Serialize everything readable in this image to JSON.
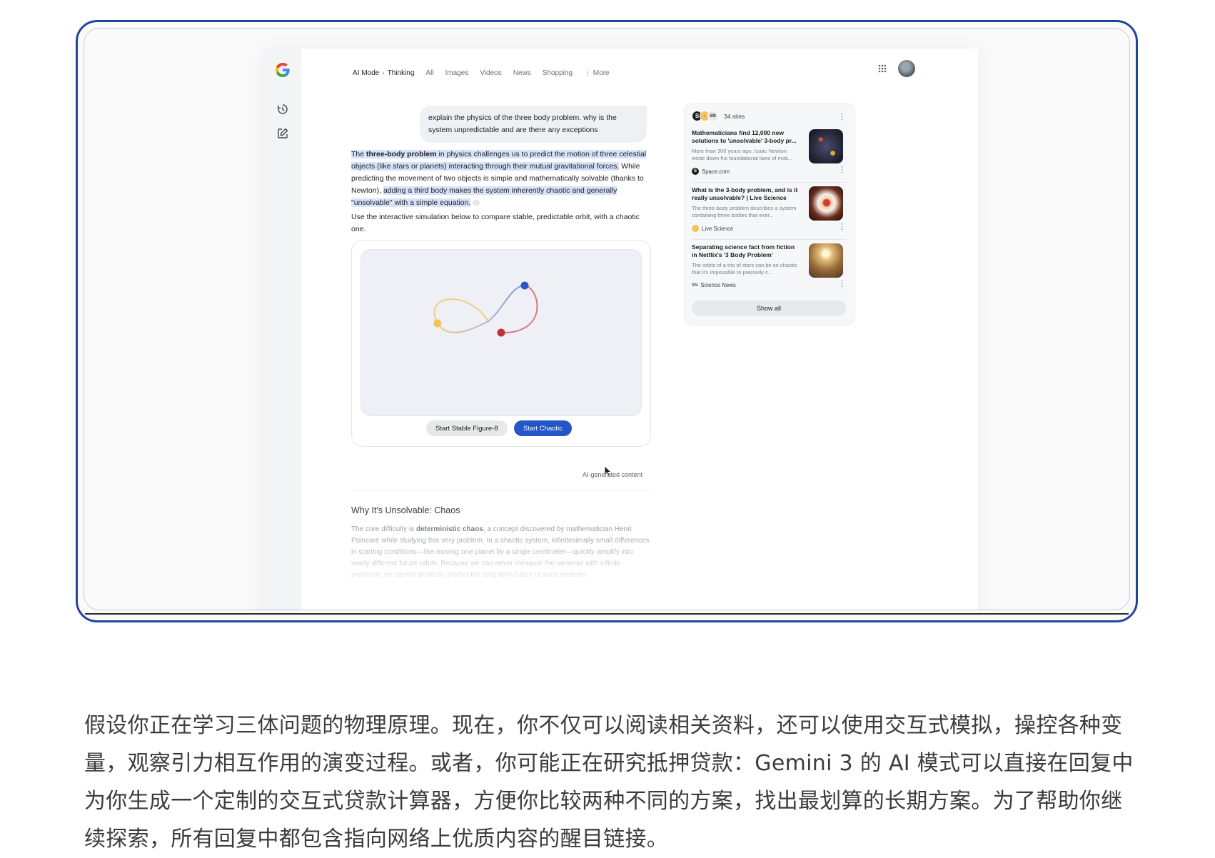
{
  "nav": {
    "mode": "AI Mode",
    "thinking": "Thinking",
    "tabs": [
      "All",
      "Images",
      "Videos",
      "News",
      "Shopping"
    ],
    "more": "More"
  },
  "chat": {
    "query": "explain the physics of the three body problem. why is the system unpredictable and are there any exceptions",
    "answer": {
      "p1": "The ",
      "p1_bold": "three-body problem",
      "p1_rest": " in physics challenges us to predict the motion of three celestial objects (like stars or planets) interacting through their mutual gravitational forces.",
      "p2": " While predicting the movement of two objects is simple and mathematically solvable (thanks to Newton), ",
      "p3": "adding a third body makes the system inherently chaotic and generally \"unsolvable\" with a simple equation."
    },
    "note": "Use the interactive simulation below to compare stable, predictable orbit, with a chaotic one.",
    "sim": {
      "btn_stable": "Start Stable Figure-8",
      "btn_chaotic": "Start Chaotic"
    },
    "ai_label": "AI-generated content",
    "section_title": "Why It's Unsolvable: Chaos",
    "section_text_pre": "The core difficulty is ",
    "section_text_bold": "deterministic chaos",
    "section_text_post": ", a concept discovered by mathematician Henri Poincaré while studying this very problem. In a chaotic system, infinitesimally small differences in starting conditions—like moving one planet by a single centimeter—quickly amplify into vastly different future orbits. Because we can never measure the universe with infinite precision, we cannot perfectly predict the long-term future of such systems."
  },
  "sources": {
    "count": "34 sites",
    "items": [
      {
        "title": "Mathematicians find 12,000 new solutions to 'unsolvable' 3-body pr...",
        "snippet": "More than 300 years ago, Isaac Newton wrote down his foundational laws of moti...",
        "site": "Space.com"
      },
      {
        "title": "What is the 3-body problem, and is it really unsolvable? | Live Science",
        "snippet": "The three-body problem describes a system containing three bodies that exer...",
        "site": "Live Science"
      },
      {
        "title": "Separating science fact from fiction in Netflix's '3 Body Problem'",
        "snippet": "The orbits of a trio of stars can be so chaotic that it's impossible to precisely c...",
        "site": "Science News"
      }
    ],
    "show_all": "Show all"
  },
  "caption": "假设你正在学习三体问题的物理原理。现在，你不仅可以阅读相关资料，还可以使用交互式模拟，操控各种变量，观察引力相互作用的演变过程。或者，你可能正在研究抵押贷款：Gemini 3 的 AI 模式可以直接在回复中为你生成一个定制的交互式贷款计算器，方便你比较两种不同的方案，找出最划算的长期方案。为了帮助你继续探索，所有回复中都包含指向网络上优质内容的醒目链接。",
  "colors": {
    "frame_border": "#23449a",
    "accent_button": "#2456c7",
    "highlight": "#d7e2fb",
    "orbit_yellow": "#f2c35a",
    "orbit_blue": "#2f55c9",
    "orbit_red": "#c0303a"
  }
}
